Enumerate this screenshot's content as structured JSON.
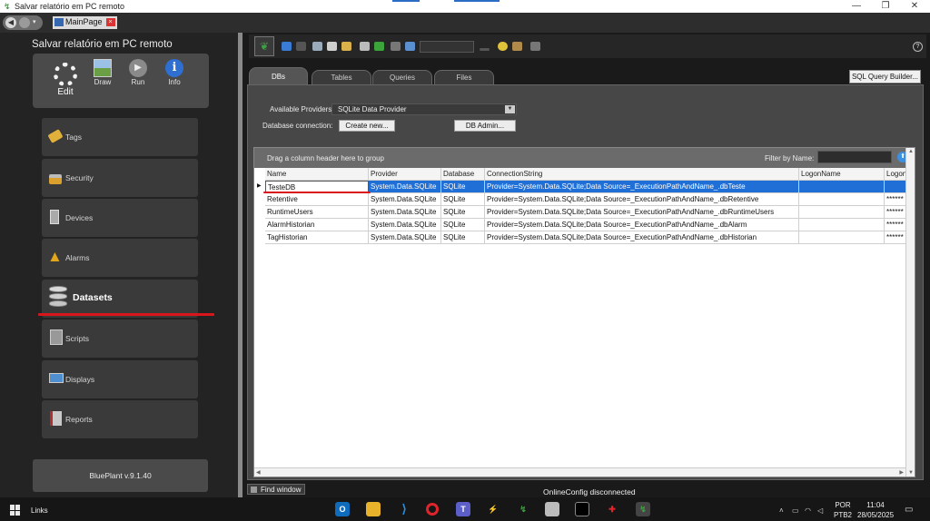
{
  "window": {
    "title": "Salvar relatório em PC remoto",
    "minimize": "—",
    "maximize": "❐",
    "close": "✕"
  },
  "topstrip": {
    "page_tab": "MainPage",
    "nav_dropdown": "▾"
  },
  "sidebar": {
    "title": "Salvar relatório em PC remoto",
    "modes": [
      {
        "label": "Edit",
        "icon": "gear-icon"
      },
      {
        "label": "Draw",
        "icon": "draw-icon"
      },
      {
        "label": "Run",
        "icon": "play-icon"
      },
      {
        "label": "Info",
        "icon": "info-icon",
        "glyph": "i"
      }
    ],
    "items": [
      {
        "label": "Tags",
        "icon": "tag-icon"
      },
      {
        "label": "Security",
        "icon": "lock-icon"
      },
      {
        "label": "Devices",
        "icon": "devices-icon"
      },
      {
        "label": "Alarms",
        "icon": "warning-icon"
      },
      {
        "label": "Datasets",
        "icon": "database-icon",
        "active": true
      },
      {
        "label": "Scripts",
        "icon": "calculator-icon"
      },
      {
        "label": "Displays",
        "icon": "monitor-icon"
      },
      {
        "label": "Reports",
        "icon": "report-icon"
      }
    ],
    "version": "BluePlant v.9.1.40"
  },
  "toolbar": {
    "help": "?"
  },
  "tabs": [
    "DBs",
    "Tables",
    "Queries",
    "Files"
  ],
  "sql_query_builder": "SQL Query Builder...",
  "providers": {
    "label": "Available Providers:",
    "value": "SQLite Data Provider"
  },
  "db_connection": {
    "label": "Database connection:",
    "create_button": "Create new...",
    "admin_button": "DB Admin..."
  },
  "grid": {
    "group_hint": "Drag a column header here to group",
    "filter_label": "Filter by Name:",
    "columns": [
      "Name",
      "Provider",
      "Database",
      "ConnectionString",
      "LogonName",
      "LogonPa"
    ],
    "rows": [
      {
        "name": "TesteDB",
        "provider": "System.Data.SQLite",
        "database": "SQLite",
        "connection": "Provider=System.Data.SQLite;Data Source=_ExecutionPathAndName_.dbTeste",
        "logon": "",
        "pass": ""
      },
      {
        "name": "Retentive",
        "provider": "System.Data.SQLite",
        "database": "SQLite",
        "connection": "Provider=System.Data.SQLite;Data Source=_ExecutionPathAndName_.dbRetentive",
        "logon": "",
        "pass": "******"
      },
      {
        "name": "RuntimeUsers",
        "provider": "System.Data.SQLite",
        "database": "SQLite",
        "connection": "Provider=System.Data.SQLite;Data Source=_ExecutionPathAndName_.dbRuntimeUsers",
        "logon": "",
        "pass": "******"
      },
      {
        "name": "AlarmHistorian",
        "provider": "System.Data.SQLite",
        "database": "SQLite",
        "connection": "Provider=System.Data.SQLite;Data Source=_ExecutionPathAndName_.dbAlarm",
        "logon": "",
        "pass": "******"
      },
      {
        "name": "TagHistorian",
        "provider": "System.Data.SQLite",
        "database": "SQLite",
        "connection": "Provider=System.Data.SQLite;Data Source=_ExecutionPathAndName_.dbHistorian",
        "logon": "",
        "pass": "******"
      }
    ]
  },
  "footer": {
    "find_window": "Find window",
    "status": "OnlineConfig disconnected"
  },
  "taskbar": {
    "links": "Links",
    "lang_top": "POR",
    "lang_bottom": "PTB2",
    "time": "11:04",
    "date": "28/05/2025"
  },
  "colors": {
    "accent": "#1f6fd6",
    "highlight_red": "#d8161b"
  }
}
